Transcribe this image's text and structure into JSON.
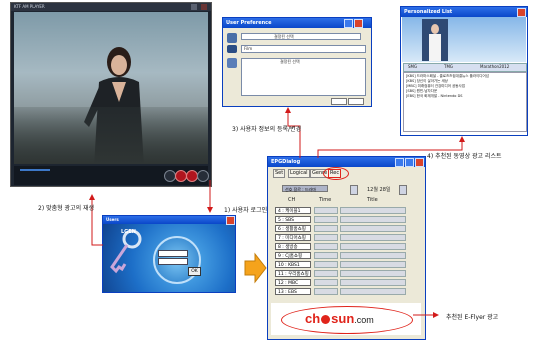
{
  "player": {
    "title": "KTF AM PLAYER"
  },
  "pref": {
    "title": "User Preference",
    "dropdown_value": "Film",
    "field_label": "결정된 선택"
  },
  "plist": {
    "title": "Personalized List",
    "tab1": "SMG",
    "tab2": "TMG",
    "tab3": "Marathon2012",
    "items": [
      "[KBS] 드라마스페셜 - 클로즈즈컵대결뉴스 플라이디어넘",
      "[KBS] 당신이 살아가는 세상",
      "[MBC] 미래컴퓨터 건강미디어 공동사업",
      "[SBS] 원빈-남자다운",
      "[EBS] 한국 화재개발 - Nintendo DS"
    ]
  },
  "epg": {
    "title": "EPGDialog",
    "menu": [
      "Set",
      "Logical",
      "Genre",
      "Rec"
    ],
    "status": "선호 장르 : 드라마",
    "date": "12월 28일",
    "col_ch": "CH",
    "col_time": "Time",
    "col_title": "Title",
    "channels": [
      "4 : 케이블1",
      "5 : SBS",
      "6 : 생활홈쇼핑",
      "7 : 미디어쇼핑",
      "8 : 생방송",
      "9 : CJ홈쇼핑",
      "10 : KBS1",
      "11 : 우리홈쇼핑",
      "12 : MBC",
      "13 : EBS"
    ],
    "banner_text_pre": "ch",
    "banner_text_post": "sun",
    "banner_domain": ".com"
  },
  "login": {
    "title": "Users",
    "ok_label": "OK",
    "brand": "LGEN"
  },
  "annotations": {
    "a1": "1) 사용자 로그인",
    "a2": "2) 맞춤형 광고의 재생",
    "a3": "3) 사용자 정보의 등록/변경",
    "a4": "4) 추천된 동영상 광고 리스트",
    "a5": "추천된 E-Flyer 광고"
  },
  "colors": {
    "accent_red": "#e0241b",
    "xp_blue": "#0a47c9"
  }
}
